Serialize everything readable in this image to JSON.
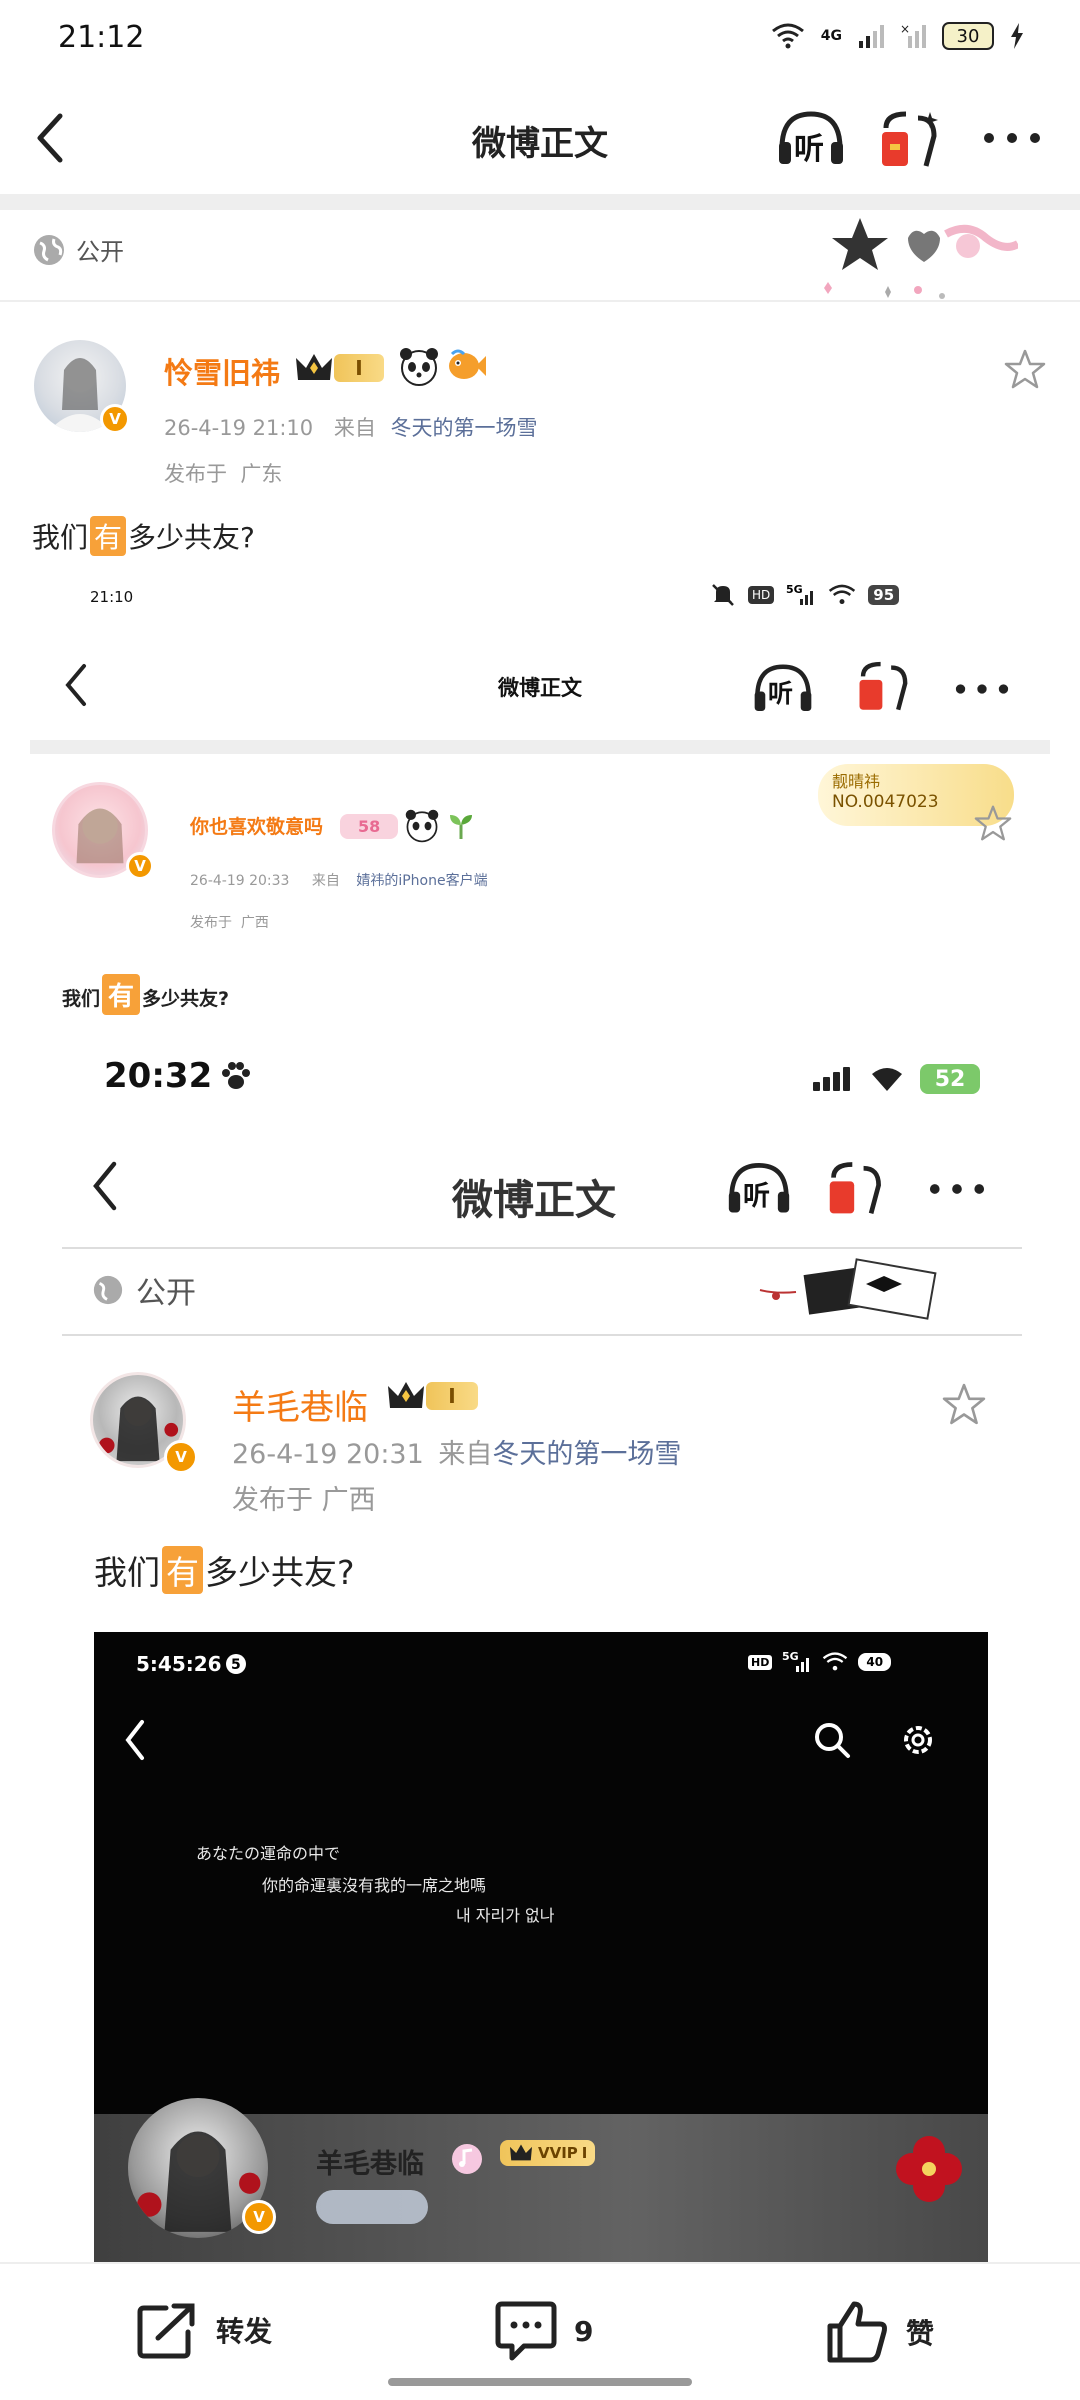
{
  "status_bar": {
    "time": "21:12",
    "network": "4G",
    "battery": "30"
  },
  "nav": {
    "title": "微博正文",
    "listen_label": "听"
  },
  "visibility": {
    "label": "公开"
  },
  "post": {
    "username": "怜雪旧祎",
    "level_badge": "I",
    "timestamp": "26-4-19  21:10",
    "source_prefix": "来自",
    "source": "冬天的第一场雪",
    "location": "发布于  广东",
    "text_before": "我们",
    "text_highlight": "有",
    "text_after": "多少共友?"
  },
  "shot1": {
    "status_time": "21:10",
    "battery": "95",
    "nav_title": "微博正文",
    "listen_label": "听",
    "fan_badge_name": "靓晴祎",
    "fan_badge_no": "NO.0047023",
    "username": "你也喜欢敬意吗",
    "level_badge": "58",
    "timestamp": "26-4-19  20:33",
    "source_prefix": "来自",
    "source": "婧祎的iPhone客户端",
    "location": "发布于  广西",
    "text_before": "我们",
    "text_highlight": "有",
    "text_after": "多少共友?"
  },
  "shot2": {
    "status_time": "20:32",
    "battery": "52",
    "nav_title": "微博正文",
    "listen_label": "听",
    "visibility": "公开",
    "username": "羊毛巷临",
    "level_badge": "I",
    "timestamp": "26-4-19 20:31",
    "source_prefix": "来自",
    "source": "冬天的第一场雪",
    "location": "发布于 广西",
    "text_before": "我们",
    "text_highlight": "有",
    "text_after": "多少共友?"
  },
  "video": {
    "time": "5:45:26",
    "battery": "40",
    "lyric_1": "あなたの運命の中で",
    "lyric_2": "你的命運裏沒有我的一席之地嗎",
    "lyric_3": "내 자리가 없나",
    "username": "羊毛巷临",
    "vip_badge": "VVIP",
    "vip_level": "I"
  },
  "toolbar": {
    "repost": "转发",
    "comments": "9",
    "like": "赞"
  }
}
